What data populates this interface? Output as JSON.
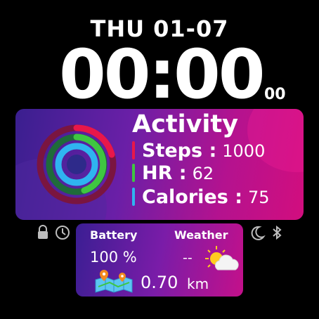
{
  "date": {
    "weekday": "THU",
    "day": "01-07"
  },
  "time": {
    "hours_minutes": "00:00",
    "seconds": "00"
  },
  "activity": {
    "title": "Activity",
    "steps_label": "Steps :",
    "steps_value": "1000",
    "hr_label": "HR :",
    "hr_value": "62",
    "calories_label": "Calories :",
    "calories_value": "75",
    "colors": {
      "steps": "#e8174a",
      "hr": "#3fc641",
      "calories": "#2fb4f0"
    }
  },
  "status_icons": [
    "lock-icon",
    "clock-icon",
    "moon-icon",
    "bluetooth-icon"
  ],
  "info": {
    "battery_label": "Battery",
    "battery_value": "100 %",
    "weather_label": "Weather",
    "weather_value": "--",
    "distance_value": "0.70",
    "distance_unit": "km"
  }
}
